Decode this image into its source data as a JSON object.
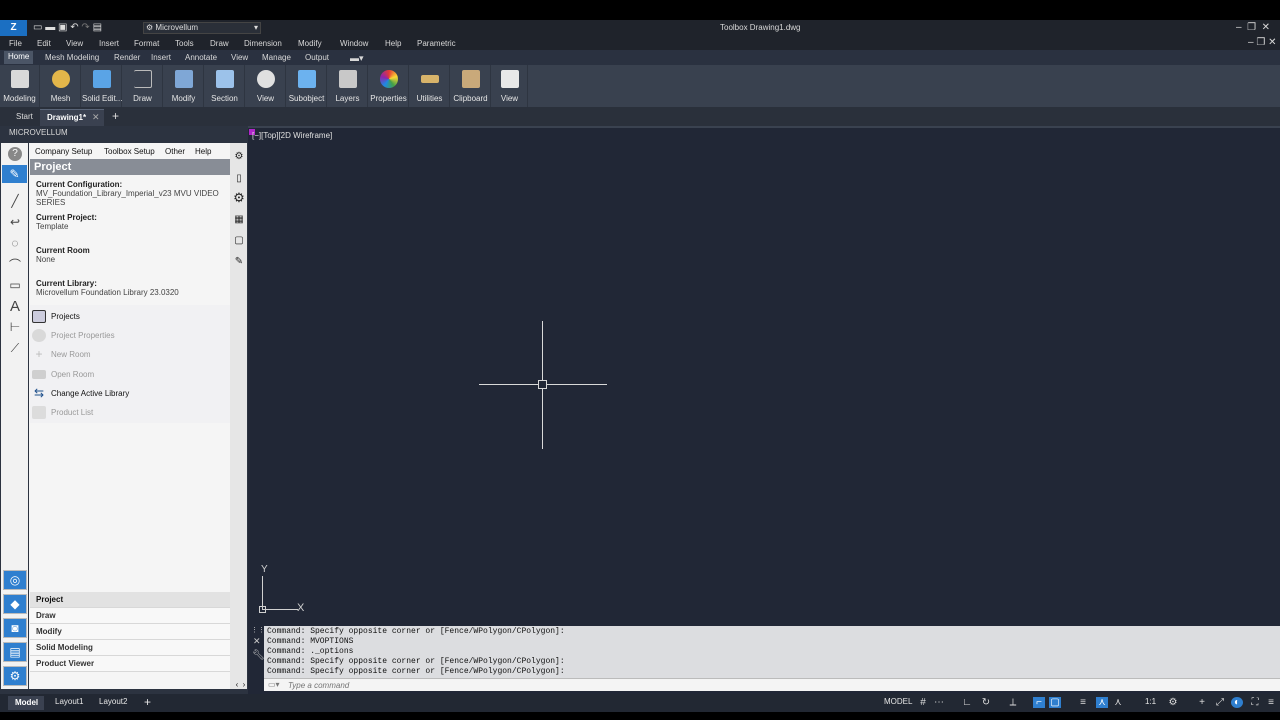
{
  "titlebar": {
    "workspace": "Microvellum",
    "title": "Toolbox   Drawing1.dwg"
  },
  "menu": [
    "File",
    "Edit",
    "View",
    "Insert",
    "Format",
    "Tools",
    "Draw",
    "Dimension",
    "Modify",
    "Window",
    "Help",
    "Parametric"
  ],
  "ribbon_tabs": [
    "Home",
    "Mesh Modeling",
    "Render",
    "Insert",
    "Annotate",
    "View",
    "Manage",
    "Output"
  ],
  "ribbon_buttons": [
    "Modeling",
    "Mesh",
    "Solid Edit...",
    "Draw",
    "Modify",
    "Section",
    "View",
    "Subobject",
    "Layers",
    "Properties",
    "Utilities",
    "Clipboard",
    "View"
  ],
  "file_tabs": {
    "start": "Start",
    "drawing": "Drawing1*",
    "add": "+"
  },
  "viewport_label": "[−][Top][2D Wireframe]",
  "panel": {
    "title": "MICROVELLUM",
    "top_menu": [
      "Company Setup",
      "Toolbox Setup",
      "Other",
      "Help"
    ],
    "header": "Project",
    "current_configuration_label": "Current Configuration:",
    "current_configuration_value": "MV_Foundation_Library_Imperial_v23 MVU VIDEO SERIES",
    "current_project_label": "Current Project:",
    "current_project_value": "Template",
    "current_room_label": "Current Room",
    "current_room_value": "None",
    "current_library_label": "Current Library:",
    "current_library_value": "Microvellum Foundation Library 23.0320",
    "actions": [
      "Projects",
      "Project Properties",
      "New Room",
      "Open Room",
      "Change Active Library",
      "Product List"
    ],
    "sections": [
      "Project",
      "Draw",
      "Modify",
      "Solid Modeling",
      "Product Viewer"
    ]
  },
  "command_log": [
    "Command: Specify opposite corner or [Fence/WPolygon/CPolygon]:",
    "Command: MVOPTIONS",
    "Command: ._options",
    "Command: Specify opposite corner or [Fence/WPolygon/CPolygon]:",
    "Command: Specify opposite corner or [Fence/WPolygon/CPolygon]:"
  ],
  "command_placeholder": "Type a command",
  "ucs": {
    "x": "X",
    "y": "Y"
  },
  "layout_tabs": [
    "Model",
    "Layout1",
    "Layout2"
  ],
  "status": {
    "model": "MODEL",
    "scale": "1:1"
  },
  "colors": {
    "accent": "#2f7fcf",
    "canvas": "#212736"
  }
}
